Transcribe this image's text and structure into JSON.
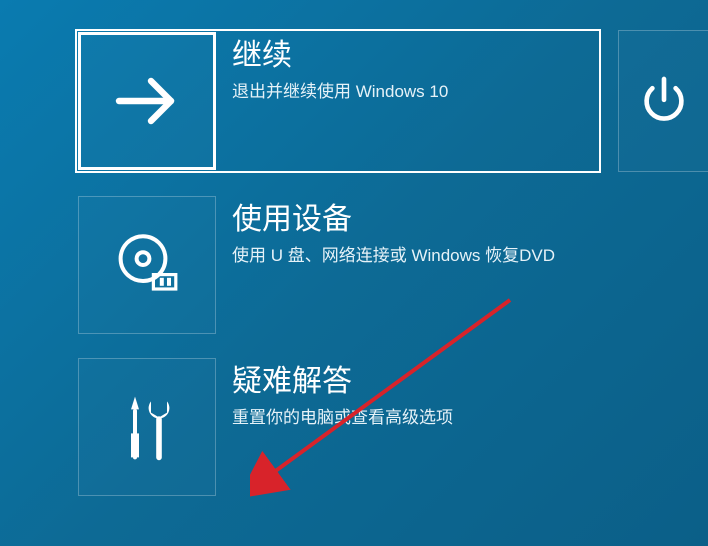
{
  "tiles": {
    "continue": {
      "title": "继续",
      "desc": "退出并继续使用 Windows 10"
    },
    "useDevice": {
      "title": "使用设备",
      "desc": "使用 U 盘、网络连接或 Windows 恢复DVD"
    },
    "troubleshoot": {
      "title": "疑难解答",
      "desc": "重置你的电脑或查看高级选项"
    }
  }
}
